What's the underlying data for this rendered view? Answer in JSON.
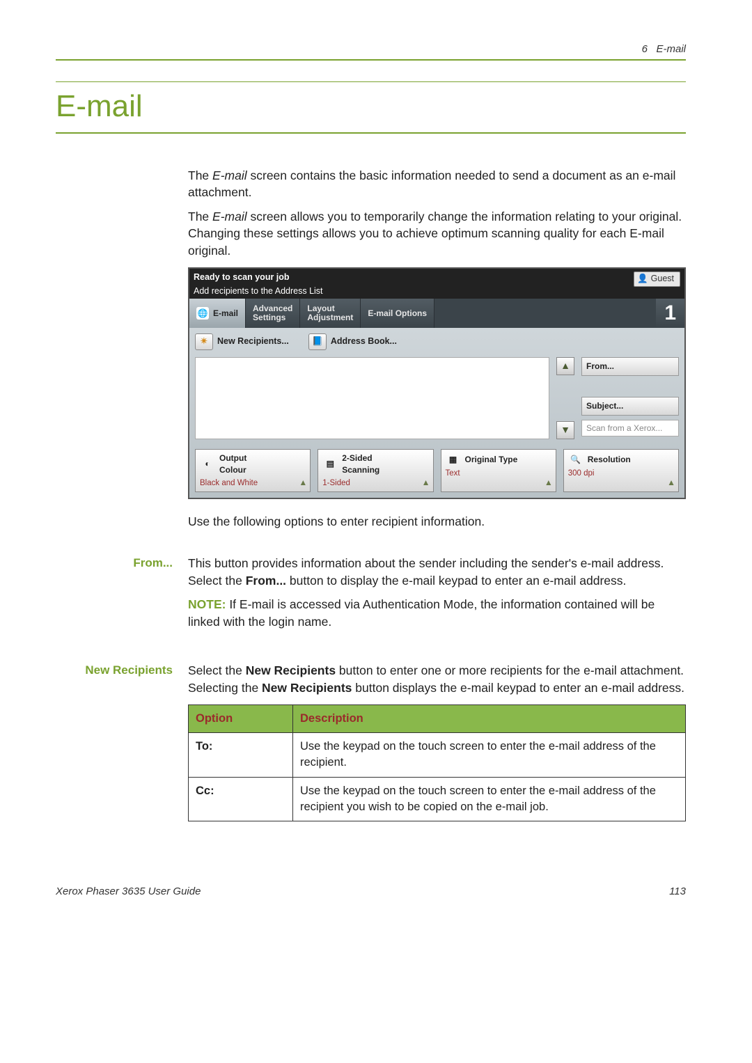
{
  "header": {
    "chapter_num": "6",
    "chapter_name": "E-mail"
  },
  "title": "E-mail",
  "intro": {
    "p1_a": "The ",
    "p1_em": "E-mail",
    "p1_b": " screen contains the basic information needed to send a document as an e-mail attachment.",
    "p2_a": "The ",
    "p2_em": "E-mail",
    "p2_b": " screen allows you to temporarily change the information relating to your original. Changing these settings allows you to achieve optimum scanning quality for each E-mail original."
  },
  "ui": {
    "ready": "Ready to scan your job",
    "add_line": "Add recipients to the Address List",
    "guest": "Guest",
    "tabs": {
      "email": "E-mail",
      "advanced": "Advanced\nSettings",
      "layout": "Layout\nAdjustment",
      "options": "E-mail Options"
    },
    "job_count": "1",
    "new_recipients": "New Recipients...",
    "address_book": "Address Book...",
    "from_btn": "From...",
    "subject_btn": "Subject...",
    "subject_value": "Scan from a Xerox...",
    "opts": {
      "output": {
        "title": "Output\nColour",
        "value": "Black and White"
      },
      "sided": {
        "title": "2-Sided\nScanning",
        "value": "1-Sided"
      },
      "orig": {
        "title": "Original Type",
        "value": "Text"
      },
      "res": {
        "title": "Resolution",
        "value": "300 dpi"
      }
    }
  },
  "after_ui": "Use the following options to enter recipient information.",
  "from_section": {
    "label": "From...",
    "body_a": "This button provides information about the sender including the sender's e-mail address. Select the ",
    "body_b": "From...",
    "body_c": " button to display the e-mail keypad to enter an e-mail address.",
    "note_label": "NOTE:",
    "note_body": " If E-mail is accessed via Authentication Mode, the information contained will be linked with the login name."
  },
  "newrec_section": {
    "label": "New Recipients",
    "body_a": "Select the ",
    "body_b": "New Recipients",
    "body_c": " button to enter one or more recipients for the e-mail attachment. Selecting the ",
    "body_d": "New Recipients",
    "body_e": " button displays the e-mail keypad to enter an e-mail address."
  },
  "table": {
    "h1": "Option",
    "h2": "Description",
    "rows": [
      {
        "opt": "To:",
        "desc": "Use the keypad on the touch screen to enter the e-mail address of the recipient."
      },
      {
        "opt": "Cc:",
        "desc": "Use the keypad on the touch screen to enter the e-mail address of the recipient you wish to be copied on the e-mail job."
      }
    ]
  },
  "footer": {
    "left": "Xerox Phaser 3635 User Guide",
    "right": "113"
  }
}
